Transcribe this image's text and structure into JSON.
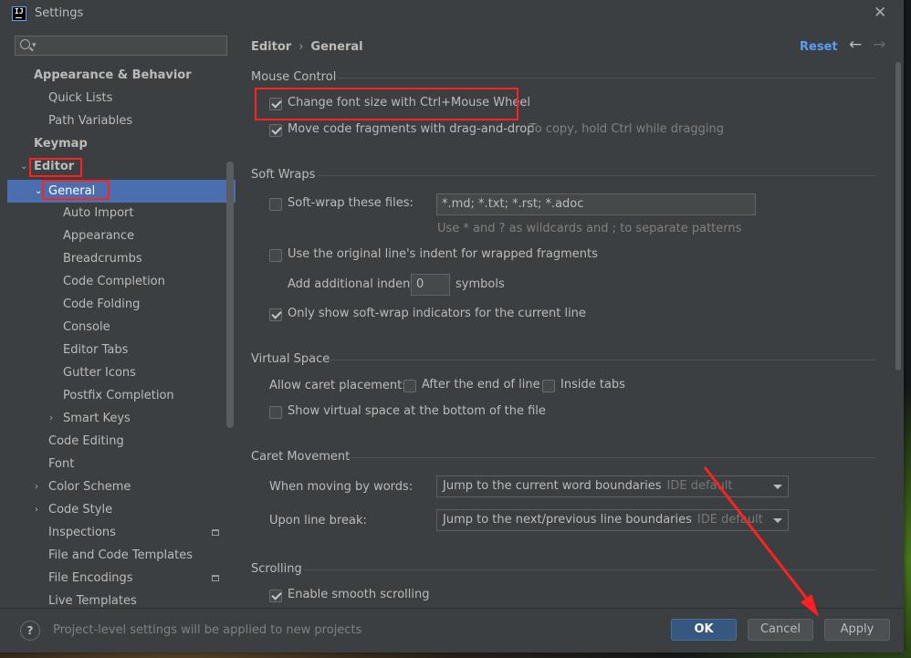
{
  "window": {
    "title": "Settings",
    "app_icon_text": "IJ"
  },
  "sidebar": {
    "items": [
      {
        "label": "Appearance & Behavior",
        "bold": true,
        "indent": 0,
        "arrow": ""
      },
      {
        "label": "Quick Lists",
        "indent": 1,
        "arrow": ""
      },
      {
        "label": "Path Variables",
        "indent": 1,
        "arrow": ""
      },
      {
        "label": "Keymap",
        "bold": true,
        "indent": 0,
        "arrow": ""
      },
      {
        "label": "Editor",
        "bold": true,
        "indent": 0,
        "arrow": "expanded"
      },
      {
        "label": "General",
        "indent": 1,
        "arrow": "expanded",
        "selected": true
      },
      {
        "label": "Auto Import",
        "indent": 2
      },
      {
        "label": "Appearance",
        "indent": 2
      },
      {
        "label": "Breadcrumbs",
        "indent": 2
      },
      {
        "label": "Code Completion",
        "indent": 2
      },
      {
        "label": "Code Folding",
        "indent": 2
      },
      {
        "label": "Console",
        "indent": 2
      },
      {
        "label": "Editor Tabs",
        "indent": 2
      },
      {
        "label": "Gutter Icons",
        "indent": 2
      },
      {
        "label": "Postfix Completion",
        "indent": 2
      },
      {
        "label": "Smart Keys",
        "indent": 2,
        "arrow": "collapsed"
      },
      {
        "label": "Code Editing",
        "indent": 1
      },
      {
        "label": "Font",
        "indent": 1
      },
      {
        "label": "Color Scheme",
        "indent": 1,
        "arrow": "collapsed"
      },
      {
        "label": "Code Style",
        "indent": 1,
        "arrow": "collapsed"
      },
      {
        "label": "Inspections",
        "indent": 1,
        "project_icon": true
      },
      {
        "label": "File and Code Templates",
        "indent": 1
      },
      {
        "label": "File Encodings",
        "indent": 1,
        "project_icon": true
      },
      {
        "label": "Live Templates",
        "indent": 1
      }
    ]
  },
  "main": {
    "breadcrumb": {
      "parent": "Editor",
      "separator": "›",
      "current": "General"
    },
    "reset_label": "Reset",
    "mouse_control": {
      "title": "Mouse Control",
      "change_font_size": {
        "label": "Change font size with Ctrl+Mouse Wheel",
        "checked": true
      },
      "move_fragments": {
        "label": "Move code fragments with drag-and-drop",
        "checked": true,
        "hint": "To copy, hold Ctrl while dragging"
      }
    },
    "soft_wraps": {
      "title": "Soft Wraps",
      "soft_wrap_files": {
        "label": "Soft-wrap these files:",
        "checked": false,
        "value": "*.md; *.txt; *.rst; *.adoc"
      },
      "patterns_hint": "Use * and ? as wildcards and ; to separate patterns",
      "original_indent": {
        "label": "Use the original line's indent for wrapped fragments",
        "checked": false
      },
      "additional_indent": {
        "label": "Add additional indent:",
        "value": "0",
        "unit": "symbols"
      },
      "only_current_line": {
        "label": "Only show soft-wrap indicators for the current line",
        "checked": true
      }
    },
    "virtual_space": {
      "title": "Virtual Space",
      "allow_caret_label": "Allow caret placement:",
      "after_end_of_line": {
        "label": "After the end of line",
        "checked": false
      },
      "inside_tabs": {
        "label": "Inside tabs",
        "checked": false
      },
      "show_virtual_space": {
        "label": "Show virtual space at the bottom of the file",
        "checked": false
      }
    },
    "caret_movement": {
      "title": "Caret Movement",
      "moving_by_words": {
        "label": "When moving by words:",
        "value": "Jump to the current word boundaries",
        "tag": "IDE default"
      },
      "upon_line_break": {
        "label": "Upon line break:",
        "value": "Jump to the next/previous line boundaries",
        "tag": "IDE default"
      }
    },
    "scrolling": {
      "title": "Scrolling",
      "smooth_scrolling": {
        "label": "Enable smooth scrolling",
        "checked": true
      }
    }
  },
  "footer": {
    "help_label": "?",
    "message": "Project-level settings will be applied to new projects",
    "ok_label": "OK",
    "cancel_label": "Cancel",
    "apply_label": "Apply"
  },
  "colors": {
    "background": "#3c3f41",
    "selection": "#4b6eaf",
    "link": "#589df6",
    "annotation_red": "#ff2020",
    "primary_button": "#365880"
  }
}
